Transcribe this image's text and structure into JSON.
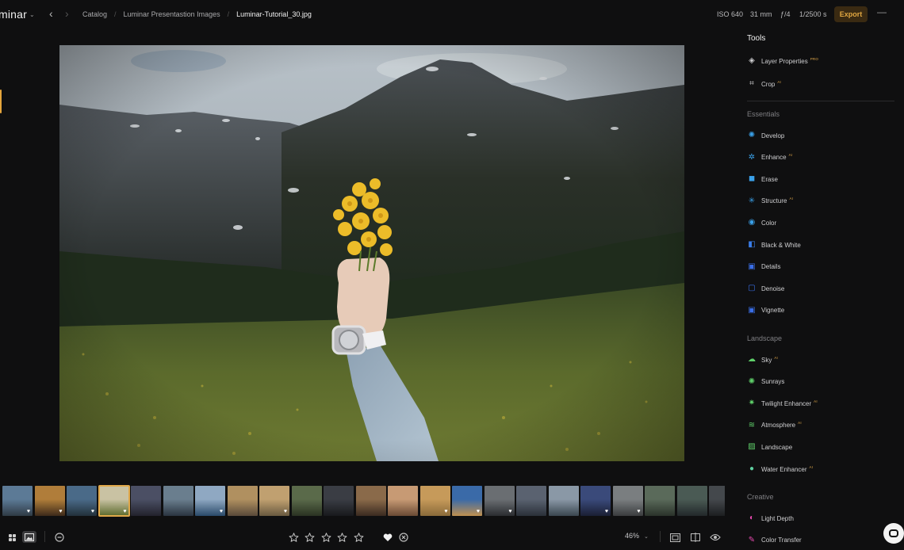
{
  "app": {
    "name": "minar"
  },
  "nav": {
    "back_icon": "chevron-left-icon",
    "forward_icon": "chevron-right-icon"
  },
  "breadcrumb": {
    "items": [
      "Catalog",
      "Luminar Presentastion Images",
      "Luminar-Tutorial_30.jpg"
    ],
    "separator": "/"
  },
  "exif": {
    "iso": "ISO 640",
    "focal": "31 mm",
    "aperture": "ƒ/4",
    "shutter": "1/2500 s"
  },
  "toolbar": {
    "export_label": "Export",
    "minimize_glyph": "—"
  },
  "panel": {
    "title": "Tools",
    "top_tools": [
      {
        "label": "Layer Properties",
        "badge": "PRO",
        "icon": "layers-icon"
      },
      {
        "label": "Crop",
        "badge": "AI",
        "icon": "crop-icon"
      }
    ],
    "sections": [
      {
        "name": "Essentials",
        "tools": [
          {
            "label": "Develop",
            "badge": "",
            "icon": "develop-icon",
            "color": "#3aa0e8"
          },
          {
            "label": "Enhance",
            "badge": "AI",
            "icon": "enhance-icon",
            "color": "#3aa0e8"
          },
          {
            "label": "Erase",
            "badge": "",
            "icon": "erase-icon",
            "color": "#3aa0e8"
          },
          {
            "label": "Structure",
            "badge": "AI",
            "icon": "structure-icon",
            "color": "#3aa0e8"
          },
          {
            "label": "Color",
            "badge": "",
            "icon": "color-icon",
            "color": "#3aa0e8"
          },
          {
            "label": "Black & White",
            "badge": "",
            "icon": "black-white-icon",
            "color": "#3a7de8"
          },
          {
            "label": "Details",
            "badge": "",
            "icon": "details-icon",
            "color": "#3a6ee8"
          },
          {
            "label": "Denoise",
            "badge": "",
            "icon": "denoise-icon",
            "color": "#3a6ee8"
          },
          {
            "label": "Vignette",
            "badge": "",
            "icon": "vignette-icon",
            "color": "#3a6ee8"
          }
        ]
      },
      {
        "name": "Landscape",
        "tools": [
          {
            "label": "Sky",
            "badge": "AI",
            "icon": "sky-icon",
            "color": "#5fd06a"
          },
          {
            "label": "Sunrays",
            "badge": "",
            "icon": "sunrays-icon",
            "color": "#5fd06a"
          },
          {
            "label": "Twilight Enhancer",
            "badge": "AI",
            "icon": "twilight-icon",
            "color": "#5fd06a"
          },
          {
            "label": "Atmosphere",
            "badge": "AI",
            "icon": "atmosphere-icon",
            "color": "#5fd06a"
          },
          {
            "label": "Landscape",
            "badge": "",
            "icon": "landscape-icon",
            "color": "#5fd06a"
          },
          {
            "label": "Water Enhancer",
            "badge": "AI",
            "icon": "water-icon",
            "color": "#5fd0a0"
          }
        ]
      },
      {
        "name": "Creative",
        "tools": [
          {
            "label": "Light Depth",
            "badge": "",
            "icon": "light-depth-icon",
            "color": "#e84ab0"
          },
          {
            "label": "Color Transfer",
            "badge": "",
            "icon": "color-transfer-icon",
            "color": "#e84ab0"
          }
        ]
      }
    ]
  },
  "viewer": {
    "zoom": "46%"
  },
  "rating": {
    "stars": 0,
    "max_stars": 5
  },
  "filmstrip": {
    "thumbnails": [
      {
        "scene": "mountain-lake",
        "favorite": true,
        "selected": false
      },
      {
        "scene": "yoga-sunset",
        "favorite": true,
        "selected": false
      },
      {
        "scene": "mountain-valley",
        "favorite": true,
        "selected": false
      },
      {
        "scene": "flower-hand",
        "favorite": true,
        "selected": true
      },
      {
        "scene": "dusk-landscape",
        "favorite": false,
        "selected": false
      },
      {
        "scene": "lake-mountains",
        "favorite": false,
        "selected": false
      },
      {
        "scene": "person-coast",
        "favorite": true,
        "selected": false
      },
      {
        "scene": "balloons",
        "favorite": false,
        "selected": false
      },
      {
        "scene": "balloons-2",
        "favorite": true,
        "selected": false
      },
      {
        "scene": "trees",
        "favorite": false,
        "selected": false
      },
      {
        "scene": "dark-landscape",
        "favorite": false,
        "selected": false
      },
      {
        "scene": "desert-dusk",
        "favorite": false,
        "selected": false
      },
      {
        "scene": "portrait",
        "favorite": false,
        "selected": false
      },
      {
        "scene": "dunes",
        "favorite": true,
        "selected": false
      },
      {
        "scene": "pagoda",
        "favorite": true,
        "selected": false
      },
      {
        "scene": "storm",
        "favorite": true,
        "selected": false
      },
      {
        "scene": "peaks",
        "favorite": false,
        "selected": false
      },
      {
        "scene": "cliffs",
        "favorite": false,
        "selected": false
      },
      {
        "scene": "night-mountains",
        "favorite": true,
        "selected": false
      },
      {
        "scene": "rocky-ridge",
        "favorite": true,
        "selected": false
      },
      {
        "scene": "hills",
        "favorite": false,
        "selected": false
      },
      {
        "scene": "forest",
        "favorite": false,
        "selected": false
      },
      {
        "scene": "edge",
        "favorite": false,
        "selected": false
      }
    ]
  }
}
